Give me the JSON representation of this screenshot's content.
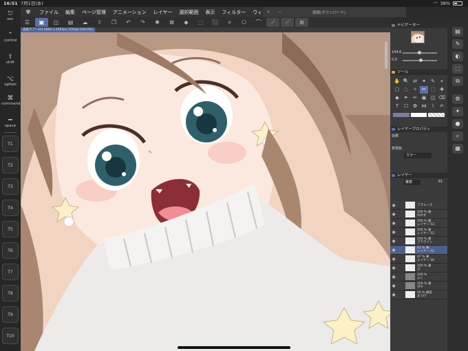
{
  "statusbar": {
    "time": "16:51",
    "date": "7月1日(水)",
    "battery": "38%"
  },
  "menu": {
    "items": [
      "ファイル",
      "編集",
      "ページ管理",
      "アニメーション",
      "レイヤー",
      "選択範囲",
      "表示",
      "フィルター",
      "ウィンドウ"
    ],
    "doc_title": "書類[ダウンロード]"
  },
  "leftbar": {
    "keys": [
      {
        "icon": "⎋",
        "label": "esc"
      },
      {
        "icon": "⌃",
        "label": "control"
      },
      {
        "icon": "⇧",
        "label": "shift"
      },
      {
        "icon": "⌥",
        "label": "option"
      },
      {
        "icon": "⌘",
        "label": "command"
      },
      {
        "icon": "━",
        "label": "space"
      }
    ],
    "tkeys": [
      "T1",
      "T2",
      "T3",
      "T4",
      "T5",
      "T6",
      "T7",
      "T8",
      "T9",
      "T10"
    ]
  },
  "canvas": {
    "title": "表紙ラフ* (A4 2894 x 4093px 350dpi 164.6%)"
  },
  "panels": {
    "navigator": {
      "title": "ナビゲーター",
      "zoom": "144.6",
      "angle": "0.0"
    },
    "tool": {
      "title": "ツール"
    },
    "layer_property": {
      "title": "レイヤープロパティ",
      "effect_label": "効果",
      "color_label": "表現色",
      "color_value": "カラー"
    },
    "layer": {
      "title": "レイヤー",
      "blend": "乗算",
      "opacity": "61"
    }
  },
  "tools": [
    "✋",
    "🔍",
    "⇄",
    "✦",
    "✎",
    "⌖",
    "▢",
    "◌",
    "✧",
    "✂",
    "⬚",
    "✚",
    "◆",
    "✒",
    "✏",
    "▣",
    "◫",
    "⌫",
    "T",
    "☐",
    "✿",
    "⋈",
    "⌇",
    "✍"
  ],
  "colors": {
    "swatch_main": "#7e7aa6",
    "swatch_sub": "#ffffff",
    "accent": "#5b6fa8"
  },
  "layers": [
    {
      "line1": "フラレース",
      "line2": ""
    },
    {
      "line1": "100 % 通",
      "line2": "れわす"
    },
    {
      "line1": "100 % 通",
      "line2": "レイヤー 53"
    },
    {
      "line1": "100 % 通",
      "line2": "レイヤー 52"
    },
    {
      "line1": "100 % 通",
      "line2": "プラライン"
    },
    {
      "line1": "61 % 乗",
      "line2": "レイヤー 51"
    },
    {
      "line1": "47 % 乗",
      "line2": "レイヤー 50"
    },
    {
      "line1": "100 % 通",
      "line2": "ぷ"
    },
    {
      "line1": "100 %",
      "line2": "ふく"
    },
    {
      "line1": "100 % 通",
      "line2": "ポケ"
    },
    {
      "line1": "50 % 通常",
      "line2": "まつげ"
    }
  ]
}
